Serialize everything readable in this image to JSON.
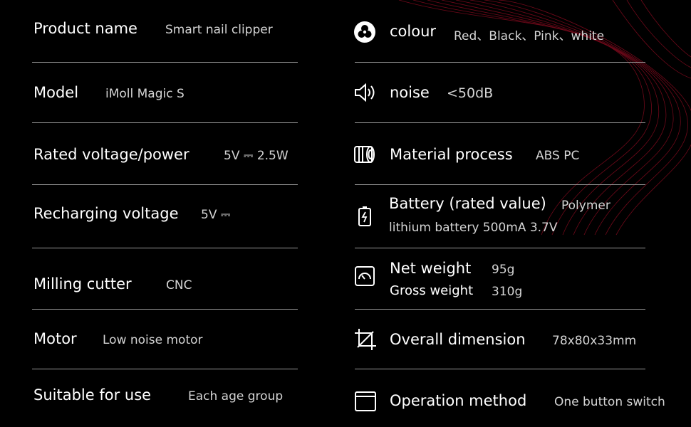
{
  "left_specs": [
    {
      "label": "Product name",
      "value": "Smart nail clipper"
    },
    {
      "label": "Model",
      "value": "iMoll Magic S"
    },
    {
      "label": "Rated voltage/power",
      "value": "5V ⎓ 2.5W"
    },
    {
      "label": "Recharging voltage",
      "value": "5V ⎓"
    },
    {
      "label": "Milling cutter",
      "value": "CNC"
    },
    {
      "label": "Motor",
      "value": "Low noise motor"
    },
    {
      "label": "Suitable for use",
      "value": "Each age group"
    }
  ],
  "right_specs": {
    "colour": {
      "label": "colour",
      "value": "Red、Black、Pink、white",
      "icon": "colour-icon"
    },
    "noise": {
      "label": "noise",
      "value": "<50dB",
      "icon": "speaker-icon"
    },
    "material": {
      "label": "Material process",
      "value": "ABS  PC",
      "icon": "material-icon"
    },
    "battery": {
      "label": "Battery (rated value)",
      "value": "Polymer",
      "value_line2": "lithium battery 500mA 3.7V",
      "icon": "battery-icon"
    },
    "weight": {
      "label": "Net weight",
      "value": "95g",
      "label2": "Gross weight",
      "value2": "310g",
      "icon": "scale-icon"
    },
    "dimension": {
      "label": "Overall dimension",
      "value": "78x80x33mm",
      "icon": "dimension-icon"
    },
    "operation": {
      "label": "Operation method",
      "value": "One button switch",
      "icon": "window-icon"
    }
  },
  "colors": {
    "background": "#000000",
    "accent": "#c8102e",
    "divider": "#9a9a9a"
  }
}
